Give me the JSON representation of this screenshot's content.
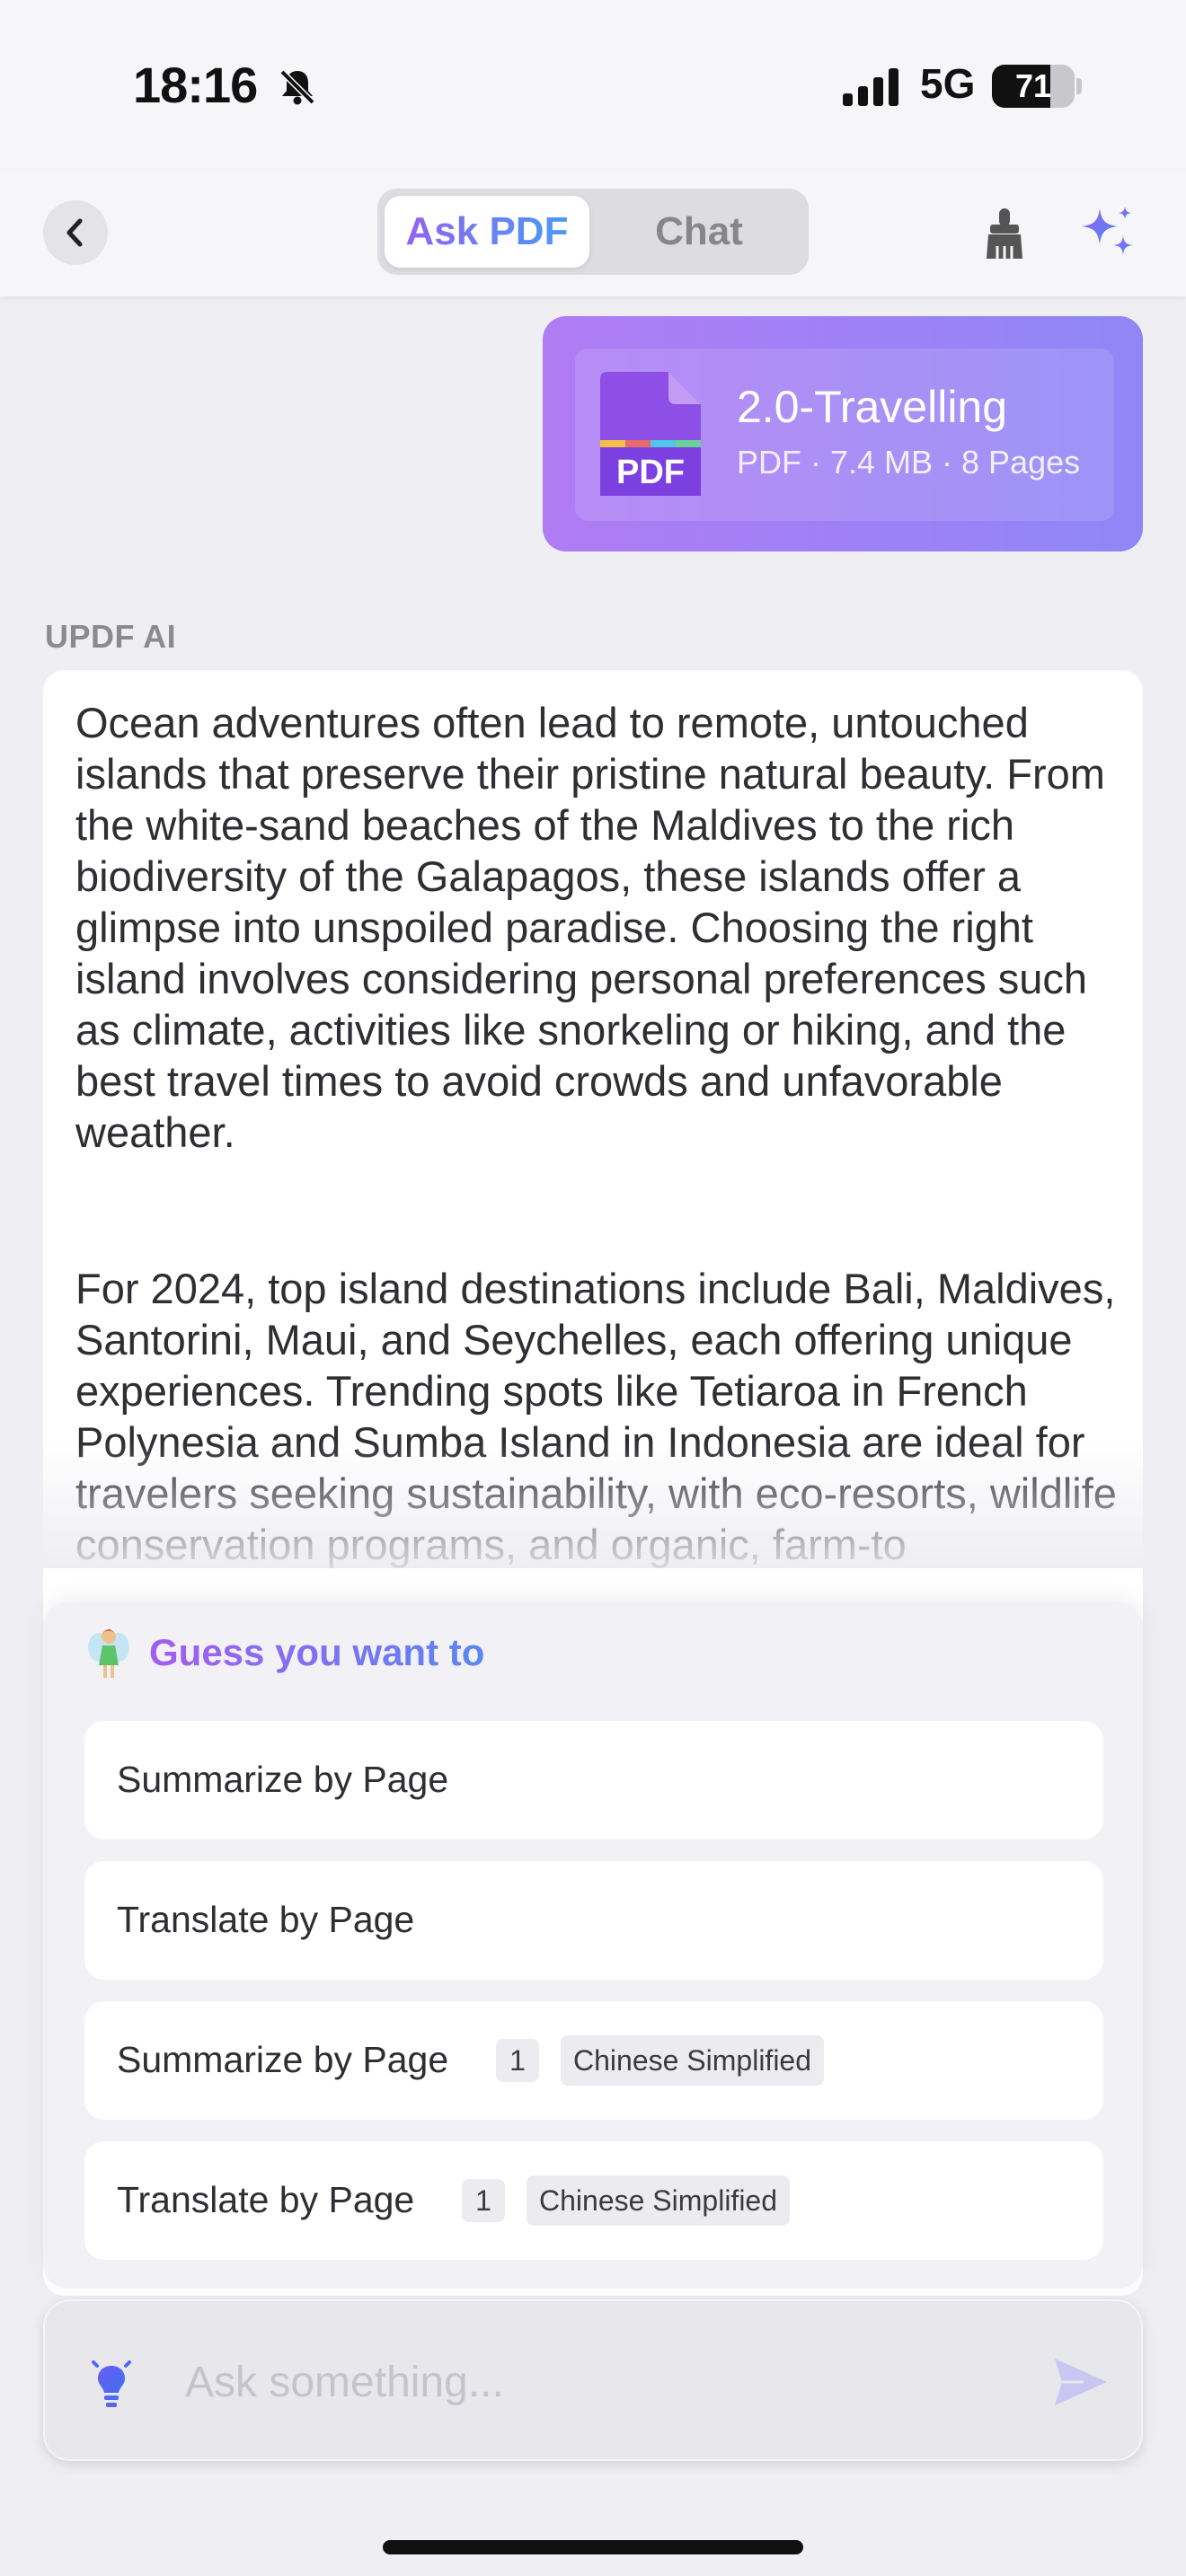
{
  "status_bar": {
    "time": "18:16",
    "network": "5G",
    "battery": "71",
    "battery_level_percent": 71,
    "icons": [
      "bell-slash-icon",
      "cellular-signal-icon",
      "battery-icon"
    ]
  },
  "nav": {
    "back_icon": "chevron-left-icon",
    "tabs": [
      {
        "label": "Ask PDF",
        "active": true
      },
      {
        "label": "Chat",
        "active": false
      }
    ],
    "right_icons": [
      "broom-icon",
      "sparkle-icon"
    ]
  },
  "file": {
    "icon_label": "PDF",
    "name": "2.0-Travelling",
    "meta": "PDF · 7.4 MB · 8 Pages"
  },
  "answer": {
    "sender": "UPDF AI",
    "paragraphs": [
      "Ocean adventures often lead to remote, untouched islands that preserve their pristine natural beauty. From the white-sand beaches of the Maldives to the rich biodiversity of the Galapagos, these islands offer a glimpse into unspoiled paradise. Choosing the right island involves considering personal preferences such as climate, activities like snorkeling or hiking, and the best travel times to avoid crowds and unfavorable weather.",
      "For 2024, top island destinations include Bali, Maldives, Santorini, Maui, and Seychelles, each offering unique experiences. Trending spots like Tetiaroa in French Polynesia and Sumba Island in Indonesia are ideal for travelers seeking sustainability, with eco-resorts, wildlife conservation programs, and organic, farm-to"
    ]
  },
  "suggestions": {
    "title": "Guess you want to",
    "icon": "fairy-icon",
    "items": [
      {
        "label": "Summarize by Page",
        "page": "",
        "language": ""
      },
      {
        "label": "Translate by Page",
        "page": "",
        "language": ""
      },
      {
        "label": "Summarize by Page",
        "page": "1",
        "language": "Chinese Simplified"
      },
      {
        "label": "Translate by Page",
        "page": "1",
        "language": "Chinese Simplified"
      }
    ]
  },
  "input": {
    "placeholder": "Ask something...",
    "value": "",
    "icons": [
      "lightbulb-icon",
      "send-icon"
    ]
  },
  "colors": {
    "accent_purple": "#9b5cf0",
    "accent_blue": "#3fa3f5",
    "file_card_start": "#b07cf4",
    "file_card_end": "#8f86f6"
  }
}
